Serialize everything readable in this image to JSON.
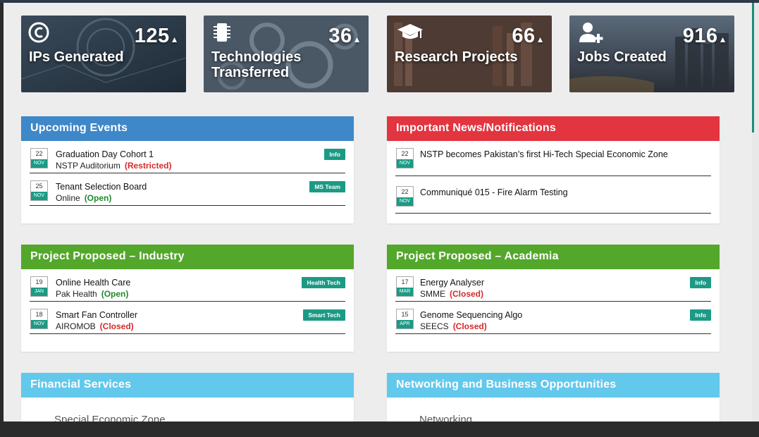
{
  "stats": [
    {
      "icon": "copyright-icon",
      "value": "125",
      "label": "IPs Generated"
    },
    {
      "icon": "chip-icon",
      "value": "36",
      "label": "Technologies Transferred"
    },
    {
      "icon": "graduation-cap-icon",
      "value": "66",
      "label": "Research Projects"
    },
    {
      "icon": "add-user-icon",
      "value": "916",
      "label": "Jobs Created"
    }
  ],
  "up_arrow": "▲",
  "events": {
    "title": "Upcoming Events",
    "items": [
      {
        "day": "22",
        "month": "NOV",
        "title": "Graduation Day Cohort 1",
        "place": "NSTP Auditorium",
        "status": "(Restricted)",
        "tag": "Info"
      },
      {
        "day": "25",
        "month": "NOV",
        "title": "Tenant Selection Board",
        "place": "Online",
        "status": "(Open)",
        "tag": "MS Team"
      }
    ]
  },
  "news": {
    "title": "Important News/Notifications",
    "items": [
      {
        "day": "22",
        "month": "NOV",
        "title": "NSTP becomes Pakistan’s first Hi-Tech Special Economic Zone"
      },
      {
        "day": "22",
        "month": "NOV",
        "title": "Communiqué 015 - Fire Alarm Testing"
      }
    ]
  },
  "industry": {
    "title": "Project Proposed – Industry",
    "items": [
      {
        "day": "19",
        "month": "JAN",
        "title": "Online Health Care",
        "org": "Pak Health",
        "status": "(Open)",
        "tag": "Health Tech"
      },
      {
        "day": "18",
        "month": "NOV",
        "title": "Smart Fan Controller",
        "org": "AIROMOB",
        "status": "(Closed)",
        "tag": "Smart Tech"
      }
    ]
  },
  "academia": {
    "title": "Project Proposed – Academia",
    "items": [
      {
        "day": "17",
        "month": "MAR",
        "title": "Energy Analyser",
        "org": "SMME",
        "status": "(Closed)",
        "tag": "Info"
      },
      {
        "day": "15",
        "month": "APR",
        "title": "Genome Sequencing Algo",
        "org": "SEECS",
        "status": "(Closed)",
        "tag": "Info"
      }
    ]
  },
  "financial": {
    "title": "Financial Services",
    "item": "Special Economic Zone"
  },
  "networking": {
    "title": "Networking and Business Opportunities",
    "item": "Networking"
  }
}
